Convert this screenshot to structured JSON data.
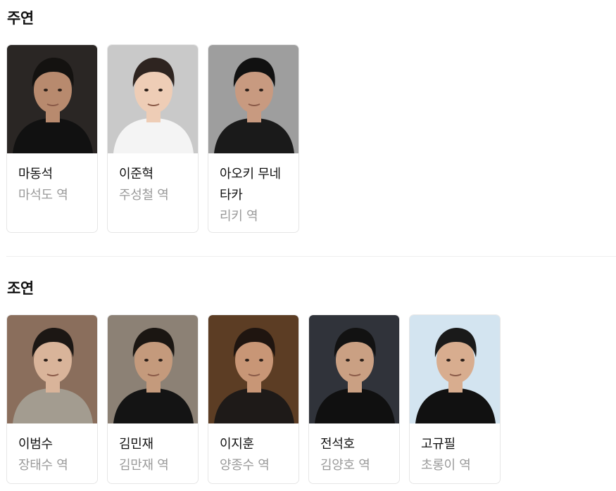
{
  "sections": [
    {
      "title": "주연",
      "cast": [
        {
          "name": "마동석",
          "role": "마석도 역",
          "bg": "#2a2624",
          "skin": "#b88a6e",
          "hair": "#141210",
          "shirt": "#111111"
        },
        {
          "name": "이준혁",
          "role": "주성철 역",
          "bg": "#c9c9c9",
          "skin": "#eecdb6",
          "hair": "#2e2420",
          "shirt": "#f4f4f4"
        },
        {
          "name": "아오키 무네타카",
          "role": "리키 역",
          "bg": "#9e9e9e",
          "skin": "#c89a80",
          "hair": "#111111",
          "shirt": "#1a1a1a"
        }
      ]
    },
    {
      "title": "조연",
      "cast": [
        {
          "name": "이범수",
          "role": "장태수 역",
          "bg": "#8a6e5c",
          "skin": "#d9b49a",
          "hair": "#1c1714",
          "shirt": "#a39c90"
        },
        {
          "name": "김민재",
          "role": "김만재 역",
          "bg": "#8c8175",
          "skin": "#c49a7c",
          "hair": "#1b1612",
          "shirt": "#141414"
        },
        {
          "name": "이지훈",
          "role": "양종수 역",
          "bg": "#5c3d24",
          "skin": "#c89676",
          "hair": "#1f1510",
          "shirt": "#1e1a18"
        },
        {
          "name": "전석호",
          "role": "김양호 역",
          "bg": "#30333a",
          "skin": "#caa083",
          "hair": "#121212",
          "shirt": "#101010"
        },
        {
          "name": "고규필",
          "role": "초롱이 역",
          "bg": "#d3e4f0",
          "skin": "#d8ad8f",
          "hair": "#1a1a1a",
          "shirt": "#111111"
        }
      ]
    }
  ]
}
